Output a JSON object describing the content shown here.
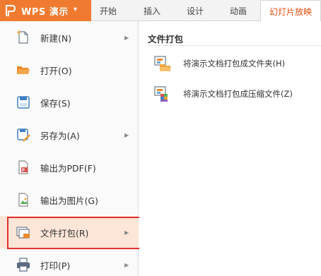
{
  "app": {
    "title": "WPS 演示",
    "caret": "▾"
  },
  "tabs": [
    {
      "label": "开始"
    },
    {
      "label": "插入"
    },
    {
      "label": "设计"
    },
    {
      "label": "动画"
    },
    {
      "label": "幻灯片放映",
      "active": true
    }
  ],
  "menu": {
    "items": [
      {
        "label": "新建(N)",
        "icon": "new-file-icon",
        "submenu": true
      },
      {
        "label": "打开(O)",
        "icon": "open-folder-icon",
        "submenu": false
      },
      {
        "label": "保存(S)",
        "icon": "save-icon",
        "submenu": false
      },
      {
        "label": "另存为(A)",
        "icon": "save-as-icon",
        "submenu": true
      },
      {
        "label": "输出为PDF(F)",
        "icon": "pdf-icon",
        "submenu": false
      },
      {
        "label": "输出为图片(G)",
        "icon": "image-export-icon",
        "submenu": false
      },
      {
        "label": "文件打包(R)",
        "icon": "package-icon",
        "submenu": true,
        "selected": true
      },
      {
        "label": "打印(P)",
        "icon": "print-icon",
        "submenu": true
      }
    ],
    "arrow": "▶"
  },
  "panel": {
    "title": "文件打包",
    "options": [
      {
        "label": "将演示文档打包成文件夹(H)",
        "icon": "package-to-folder-icon"
      },
      {
        "label": "将演示文档打包成压缩文件(Z)",
        "icon": "package-to-zip-icon"
      }
    ]
  },
  "colors": {
    "accent": "#f07b30",
    "highlight": "#fde6d7",
    "frame": "#e0312c",
    "active_tab_text": "#e34d0c"
  }
}
